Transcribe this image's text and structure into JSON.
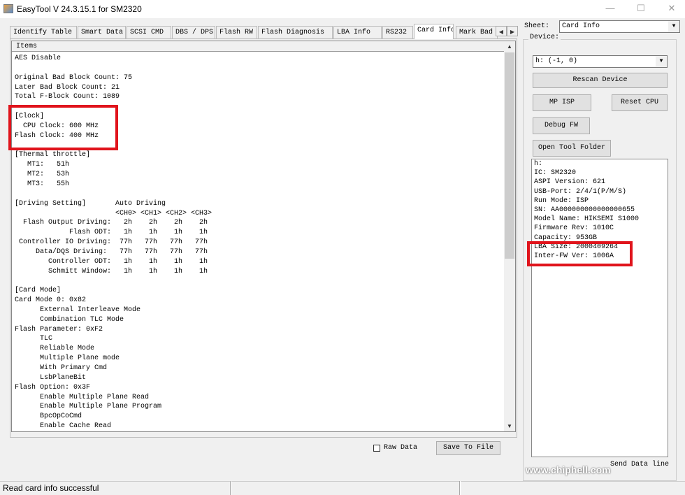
{
  "window": {
    "title": "EasyTool  V 24.3.15.1   for SM2320",
    "minimize": "—",
    "maximize": "☐",
    "close": "✕"
  },
  "tabs": [
    "Identify Table",
    "Smart Data",
    "SCSI CMD",
    "DBS / DPS",
    "Flash RW",
    "Flash Diagnosis",
    "LBA Info",
    "RS232",
    "Card Info",
    "Mark Bad In"
  ],
  "active_tab": "Card Info",
  "list": {
    "header": "Items",
    "lines": [
      "AES Disable",
      "",
      "Original Bad Block Count: 75",
      "Later Bad Block Count: 21",
      "Total F-Block Count: 1089",
      "",
      "[Clock]",
      "  CPU Clock: 600 MHz",
      "Flash Clock: 400 MHz",
      "",
      "[Thermal throttle]",
      "   MT1:   51h",
      "   MT2:   53h",
      "   MT3:   55h",
      "",
      "[Driving Setting]       Auto Driving",
      "                        <CH0> <CH1> <CH2> <CH3>",
      "  Flash Output Driving:   2h    2h    2h    2h",
      "             Flash ODT:   1h    1h    1h    1h",
      " Controller IO Driving:  77h   77h   77h   77h",
      "     Data/DQS Driving:   77h   77h   77h   77h",
      "        Controller ODT:   1h    1h    1h    1h",
      "        Schmitt Window:   1h    1h    1h    1h",
      "",
      "[Card Mode]",
      "Card Mode 0: 0x82",
      "      External Interleave Mode",
      "      Combination TLC Mode",
      "Flash Parameter: 0xF2",
      "      TLC",
      "      Reliable Mode",
      "      Multiple Plane mode",
      "      With Primary Cmd",
      "      LsbPlaneBit",
      "Flash Option: 0x3F",
      "      Enable Multiple Plane Read",
      "      Enable Multiple Plane Program",
      "      BpcOpCoCmd",
      "      Enable Cache Read"
    ]
  },
  "bottom": {
    "raw_data": "Raw Data",
    "save": "Save To File"
  },
  "sheet": {
    "label": "Sheet:",
    "value": "Card Info"
  },
  "device": {
    "label": "Device:",
    "value": "h: (-1, 0)",
    "rescan": "Rescan Device",
    "mp_isp": "MP ISP",
    "reset_cpu": "Reset CPU",
    "debug_fw": "Debug FW",
    "open_folder": "Open Tool Folder",
    "send": "Send Data line",
    "info": [
      "h:",
      "IC: SM2320",
      "ASPI Version: 621",
      "USB-Port: 2/4/1(P/M/S)",
      "Run Mode: ISP",
      "SN: AA000000000000000655",
      "Model Name: HIKSEMI S1000",
      "Firmware Rev: 1010C",
      "Capacity: 953GB",
      "LBA Size: 2000409264",
      "Inter-FW Ver: 1006A"
    ]
  },
  "status": "Read card info successful",
  "watermark": "www.chiphell.com",
  "colors": {
    "highlight": "#e0141c"
  }
}
